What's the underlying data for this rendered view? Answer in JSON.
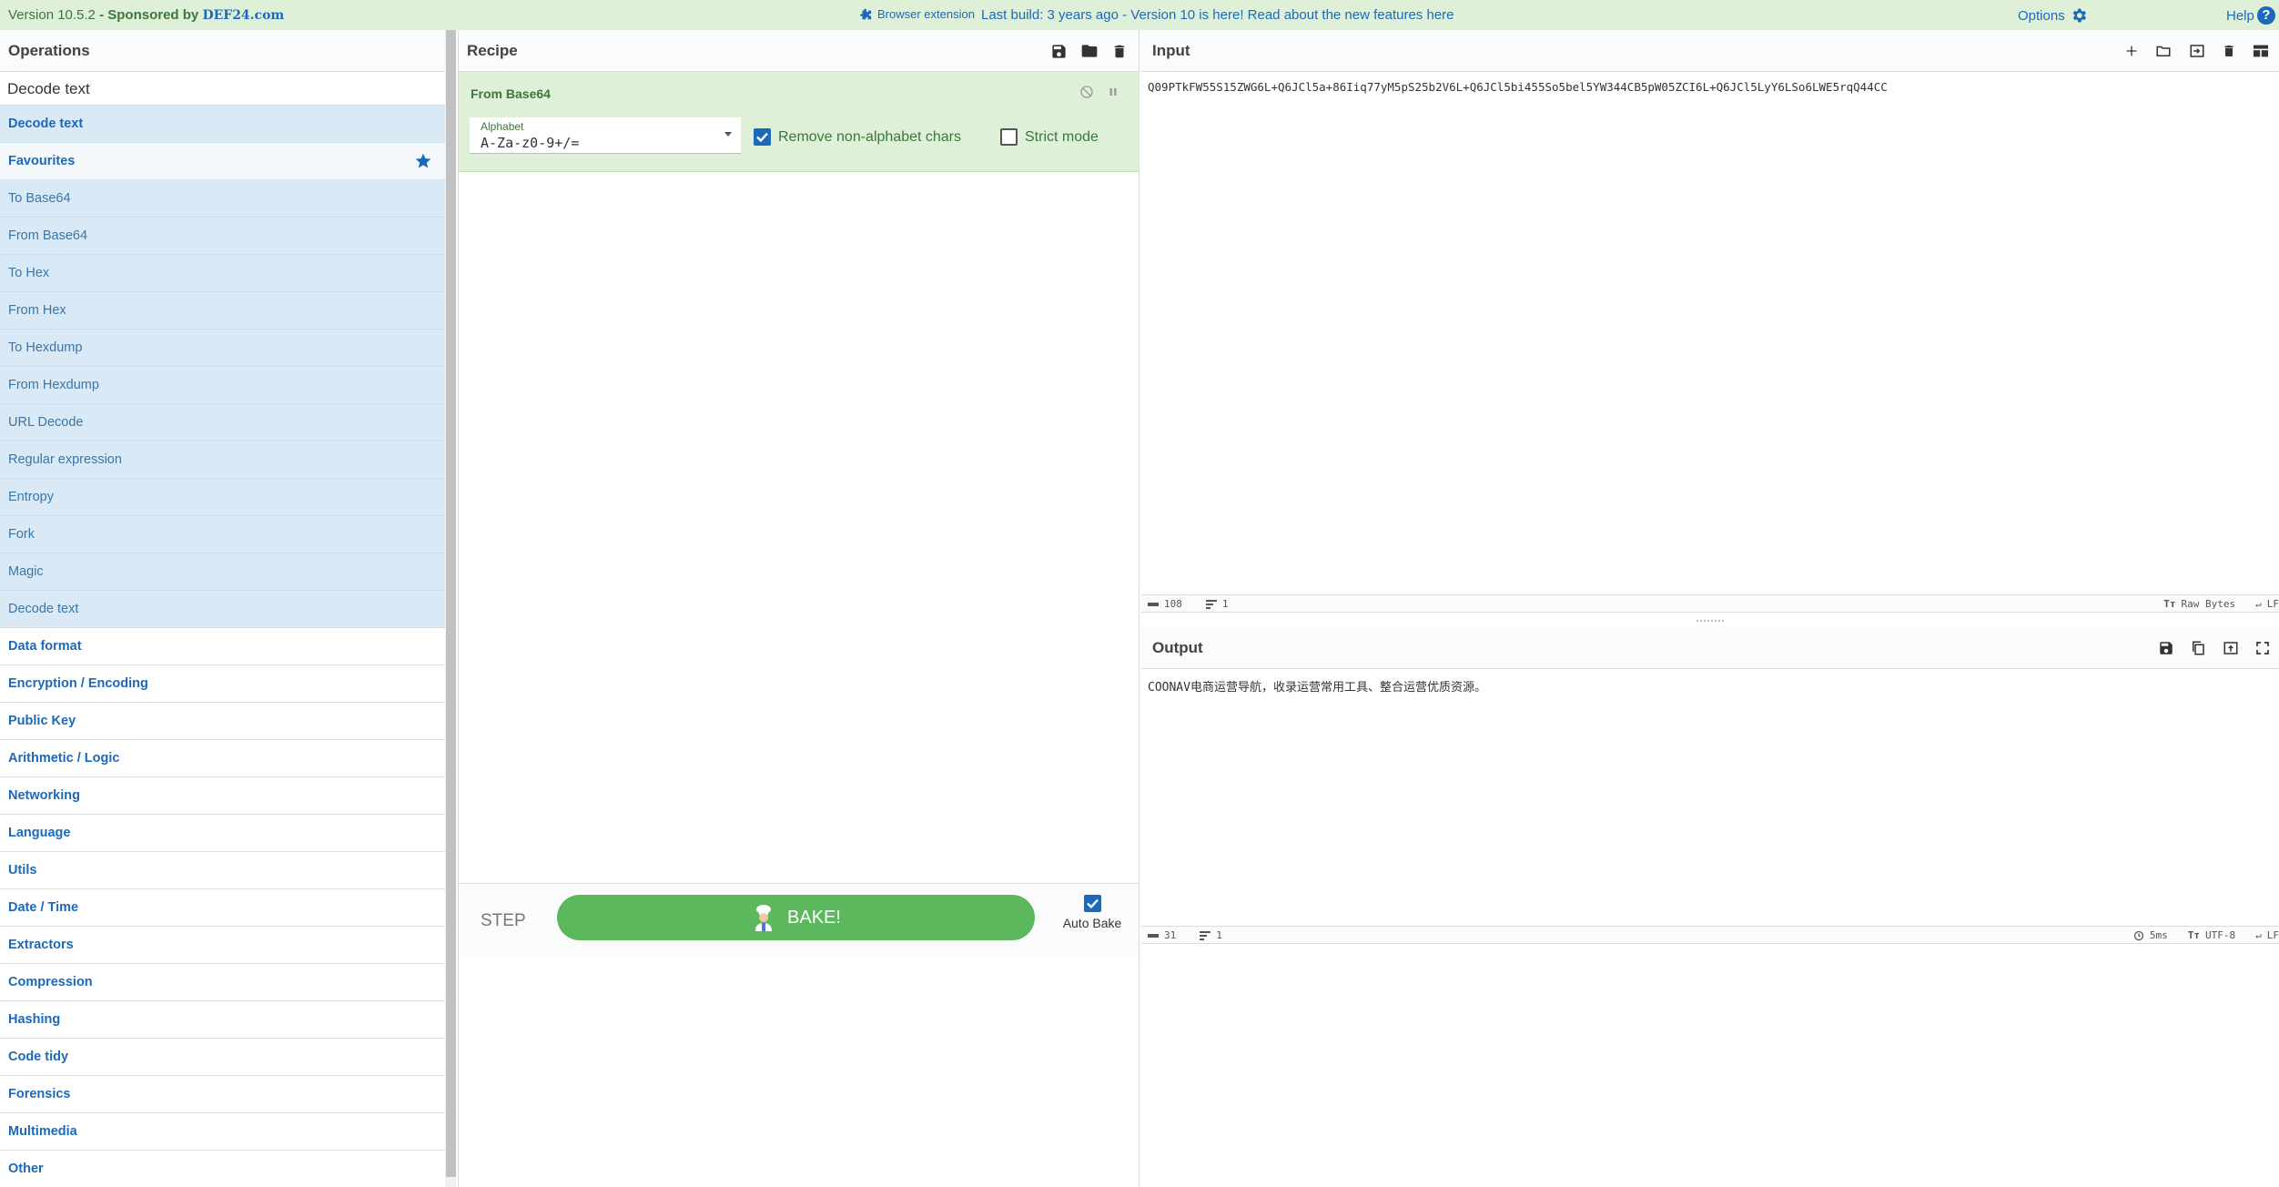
{
  "banner": {
    "version": "Version 10.5.2",
    "separator": " - ",
    "sponsored_by": "Sponsored by ",
    "sponsor_name": "DEF24.com",
    "browser_extension": "Browser extension",
    "notice_prefix": "Last build: 3 years ago - Version 10 is here! Read about the new features ",
    "notice_link": "here",
    "options": "Options",
    "help": "Help"
  },
  "operations": {
    "title": "Operations",
    "search_value": "Decode text",
    "search_result": "Decode text",
    "favourites_label": "Favourites",
    "favourites": [
      "To Base64",
      "From Base64",
      "To Hex",
      "From Hex",
      "To Hexdump",
      "From Hexdump",
      "URL Decode",
      "Regular expression",
      "Entropy",
      "Fork",
      "Magic",
      "Decode text"
    ],
    "categories": [
      "Data format",
      "Encryption / Encoding",
      "Public Key",
      "Arithmetic / Logic",
      "Networking",
      "Language",
      "Utils",
      "Date / Time",
      "Extractors",
      "Compression",
      "Hashing",
      "Code tidy",
      "Forensics",
      "Multimedia",
      "Other"
    ]
  },
  "recipe": {
    "title": "Recipe",
    "operation_name": "From Base64",
    "alphabet_label": "Alphabet",
    "alphabet_value": "A-Za-z0-9+/=",
    "remove_non_alphabet": "Remove non-alphabet chars",
    "remove_non_alphabet_checked": true,
    "strict_mode": "Strict mode",
    "strict_mode_checked": false,
    "step_label": "STEP",
    "bake_label": "BAKE!",
    "auto_bake_label": "Auto Bake",
    "auto_bake_checked": true
  },
  "input": {
    "title": "Input",
    "text": "Q09PTkFW55S15ZWG6L+Q6JCl5a+86Iiq77yM5pS25b2V6L+Q6JCl5bi455So5bel5YW344CB5pW05ZCI6L+Q6JCl5LyY6LSo6LWE5rqQ44CC",
    "length": "108",
    "lines": "1",
    "encoding": "Raw Bytes",
    "eol": "LF"
  },
  "output": {
    "title": "Output",
    "text": "COONAV电商运营导航，收录运营常用工具、整合运营优质资源。",
    "length": "31",
    "lines": "1",
    "time": "5ms",
    "encoding": "UTF-8",
    "eol": "LF"
  },
  "colors": {
    "banner_bg": "#dff0d8",
    "banner_text": "#3c763d",
    "link_blue": "#1d69b9",
    "highlight_bg": "#d9eaf6",
    "recipe_op_bg": "#dff0d8",
    "bake_green": "#5cb85c"
  }
}
